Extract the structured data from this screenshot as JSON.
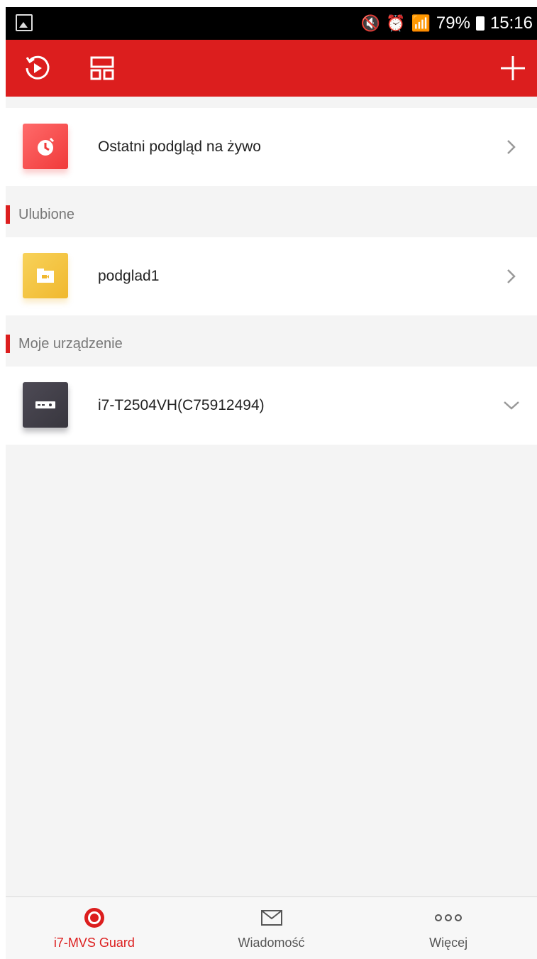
{
  "status_bar": {
    "battery": "79%",
    "time": "15:16"
  },
  "app_bar": {
    "icons": [
      "playback-history-icon",
      "layout-icon",
      "add-icon"
    ]
  },
  "recent": {
    "label": "Ostatni podgląd na żywo"
  },
  "favorites": {
    "section_title": "Ulubione",
    "items": [
      {
        "label": "podglad1"
      }
    ]
  },
  "devices": {
    "section_title": "Moje urządzenie",
    "items": [
      {
        "label": "i7-T2504VH(C75912494)"
      }
    ]
  },
  "bottom_nav": {
    "tabs": [
      {
        "label": "i7-MVS Guard",
        "icon": "camera-icon",
        "active": true
      },
      {
        "label": "Wiadomość",
        "icon": "envelope-icon",
        "active": false
      },
      {
        "label": "Więcej",
        "icon": "more-icon",
        "active": false
      }
    ]
  },
  "colors": {
    "accent": "#dc1e1e",
    "background": "#f4f4f4"
  }
}
